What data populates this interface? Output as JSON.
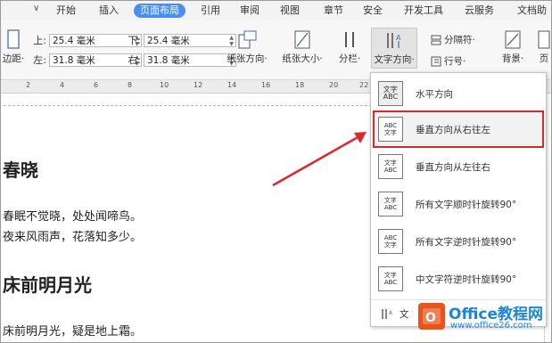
{
  "menubar": {
    "quick_access": "∨",
    "tabs": [
      "开始",
      "插入",
      "页面布局",
      "引用",
      "审阅",
      "视图",
      "章节",
      "安全",
      "开发工具",
      "云服务",
      "文档助"
    ],
    "active_tab": "页面布局"
  },
  "ribbon": {
    "margins": {
      "top_label": "上:",
      "top_value": "25.4 毫米",
      "bottom_label": "下:",
      "bottom_value": "25.4 毫米",
      "left_label": "左:",
      "left_value": "31.8 毫米",
      "right_label": "右:",
      "right_value": "31.8 毫米"
    },
    "left_cut_label": "边距·",
    "buttons": {
      "orientation": "纸张方向·",
      "size": "纸张大小·",
      "columns": "分栏·",
      "text_direction": "文字方向·",
      "separator": "分隔符·",
      "line_number": "行号·",
      "background": "背景·",
      "page_cut": "页"
    }
  },
  "ruler": {
    "numbers": [
      "2",
      "4",
      "6",
      "8",
      "10",
      "12",
      "14",
      "16",
      "18",
      "20",
      "22"
    ]
  },
  "document": {
    "title1": "春晓",
    "line1": "春眠不觉晓，处处闻啼鸟。",
    "line2": "夜来风雨声，花落知多少。",
    "title2": "床前明月光",
    "line3": "床前明月光，疑是地上霜。"
  },
  "dropdown": {
    "items": [
      {
        "label": "水平方向",
        "icon": "文字\nABC"
      },
      {
        "label": "垂直方向从右往左",
        "icon": "ABC 文字"
      },
      {
        "label": "垂直方向从左往右",
        "icon": "文字 ABC"
      },
      {
        "label": "所有文字顺时针旋转90°",
        "icon": "文字 ABC"
      },
      {
        "label": "所有文字逆时针旋转90°",
        "icon": "ABC 文字"
      },
      {
        "label": "中文字符逆时针旋转90°",
        "icon": "文字\nABC"
      }
    ],
    "footer": "文"
  },
  "watermark": {
    "brand": "Office教程网",
    "url": "www.office26.com"
  },
  "colors": {
    "accent": "#4a8ef0",
    "highlight": "#d9272c",
    "arrow": "#e0262b",
    "watermark": "#1b86d8"
  }
}
